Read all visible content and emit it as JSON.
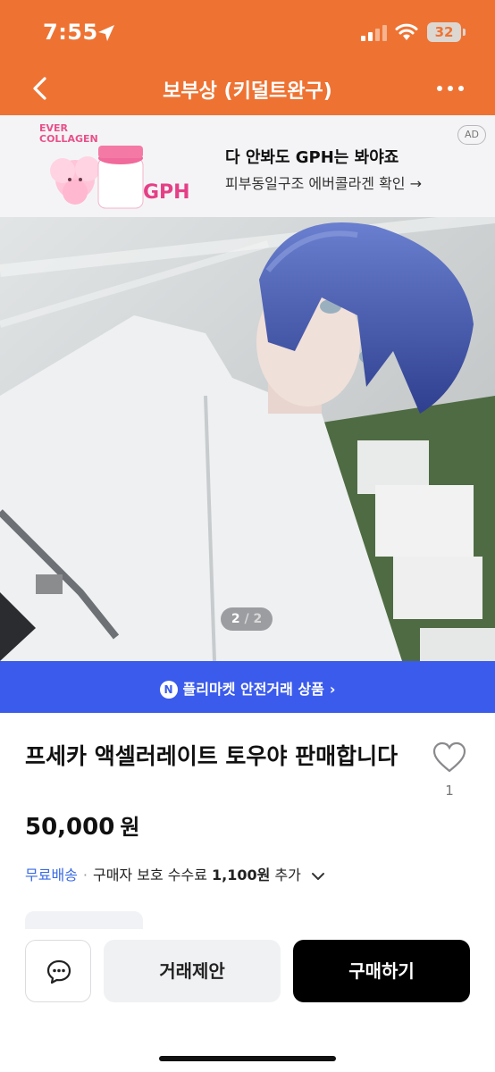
{
  "status_bar": {
    "time": "7:55",
    "battery": "32"
  },
  "header": {
    "title": "보부상 (키덜트완구)"
  },
  "ad": {
    "brand_line1": "EVER",
    "brand_line2": "COLLAGEN",
    "product_text": "GPH",
    "title": "다 안봐도 GPH는 봐야죠",
    "subtitle": "피부동일구조 에버콜라겐 확인 →",
    "badge": "AD"
  },
  "gallery": {
    "current": "2",
    "separator": "/",
    "total": "2"
  },
  "safe_trade": {
    "icon_letter": "N",
    "label": "플리마켓 안전거래 상품",
    "chevron": "›"
  },
  "product": {
    "title": "프세카 액셀러레이트 토우야 판매합니다",
    "likes": "1",
    "price": "50,000",
    "currency": "원"
  },
  "shipping": {
    "free": "무료배송",
    "separator": "·",
    "fee_label": "구매자 보호 수수료",
    "fee_amount": "1,100원",
    "fee_suffix": "추가"
  },
  "actions": {
    "offer": "거래제안",
    "buy": "구매하기"
  },
  "colors": {
    "header": "#ee7333",
    "safe_bar": "#3b5bec",
    "free_shipping": "#3a6ae5",
    "buy_button": "#000000"
  }
}
